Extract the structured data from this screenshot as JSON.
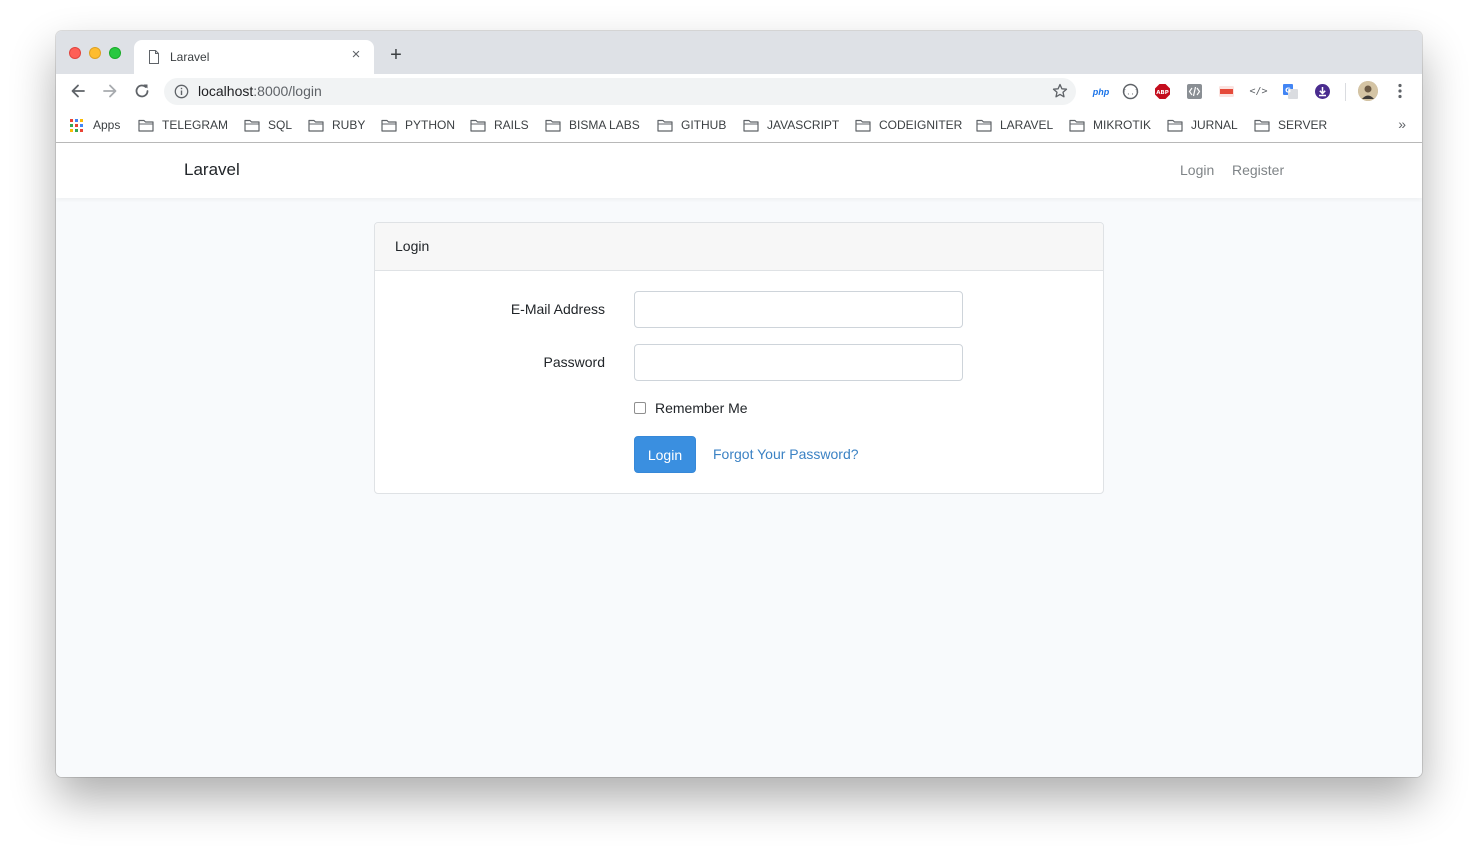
{
  "browser": {
    "tab_title": "Laravel",
    "new_tab_symbol": "+",
    "close_symbol": "×",
    "url_host": "localhost",
    "url_rest": ":8000/login",
    "extensions": [
      {
        "name": "php-extension-icon",
        "label": "php",
        "color": "#1a73e8"
      },
      {
        "name": "json-viewer-extension-icon",
        "label": "",
        "color": "#5f6368"
      },
      {
        "name": "adblock-extension-icon",
        "label": "ABP",
        "color": "#c40d1d"
      },
      {
        "name": "web-developer-extension-icon",
        "label": "",
        "color": "#8a8f94"
      },
      {
        "name": "pdf-extension-icon",
        "label": "",
        "color": "#e54a3a"
      },
      {
        "name": "code-extension-icon",
        "label": "</>",
        "color": "#5f6368"
      },
      {
        "name": "google-translate-extension-icon",
        "label": "",
        "color": "#4285f4"
      },
      {
        "name": "download-extension-icon",
        "label": "",
        "color": "#5e35b1"
      }
    ],
    "bookmarks": {
      "apps_label": "Apps",
      "folders": [
        "TELEGRAM",
        "SQL",
        "RUBY",
        "PYTHON",
        "RAILS",
        "BISMA LABS",
        "GITHUB",
        "JAVASCRIPT",
        "CODEIGNITER",
        "LARAVEL",
        "MIKROTIK",
        "JURNAL",
        "SERVER"
      ],
      "more_symbol": "»"
    }
  },
  "app": {
    "brand": "Laravel",
    "nav": {
      "login": "Login",
      "register": "Register"
    },
    "card": {
      "header": "Login",
      "email_label": "E-Mail Address",
      "email_value": "",
      "password_label": "Password",
      "password_value": "",
      "remember_label": "Remember Me",
      "login_button": "Login",
      "forgot_link": "Forgot Your Password?"
    }
  },
  "colors": {
    "primary_button": "#3a8fe0",
    "link": "#3b82c4",
    "page_background": "#f8fafc"
  }
}
